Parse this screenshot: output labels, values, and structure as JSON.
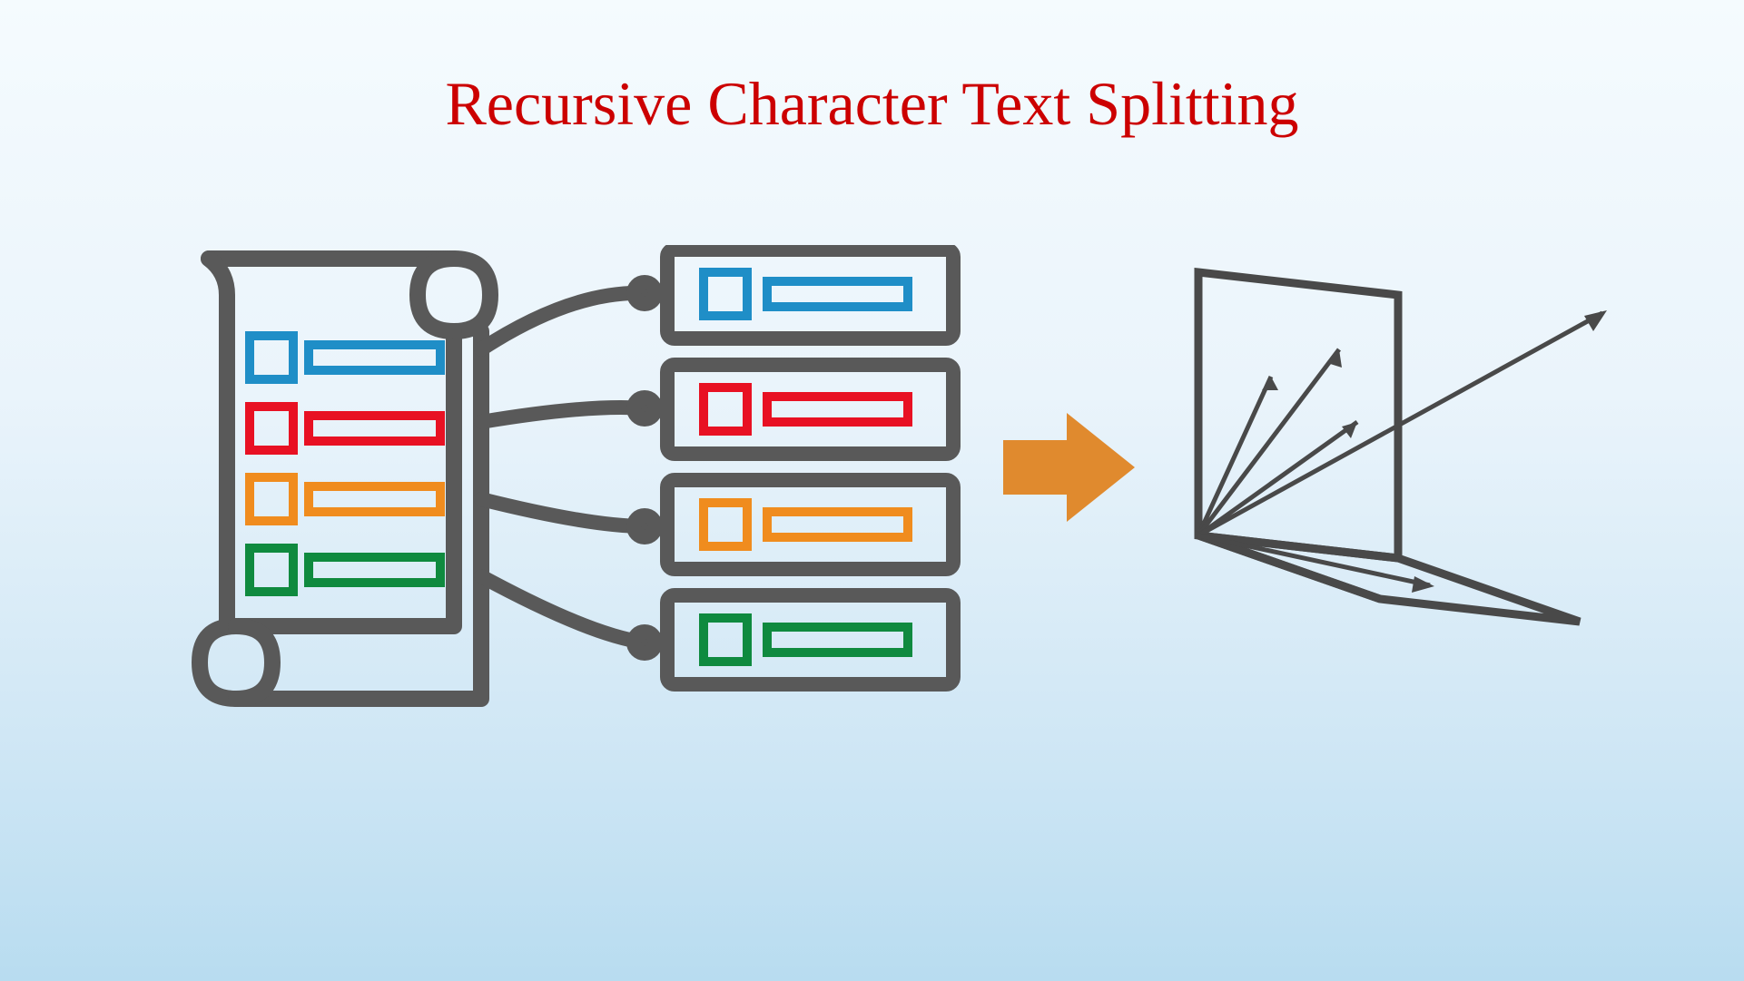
{
  "title": "Recursive Character Text Splitting",
  "colors": {
    "title": "#cc0000",
    "outline": "#595959",
    "blue": "#1f8ec7",
    "red": "#e81123",
    "orange": "#f08c1e",
    "green": "#0f8a3f",
    "arrow": "#e08a2e"
  },
  "diagram": {
    "description": "A document/scroll containing four colored rows (blue, red, orange, green) connects via curved lines to four separate chunks/boxes, each containing the same colored elements. An orange arrow points to a 3D coordinate space representation with vectors emanating from origin.",
    "source_rows": [
      {
        "color": "blue"
      },
      {
        "color": "red"
      },
      {
        "color": "orange"
      },
      {
        "color": "green"
      }
    ],
    "chunks": [
      {
        "color": "blue"
      },
      {
        "color": "red"
      },
      {
        "color": "orange"
      },
      {
        "color": "green"
      }
    ]
  }
}
